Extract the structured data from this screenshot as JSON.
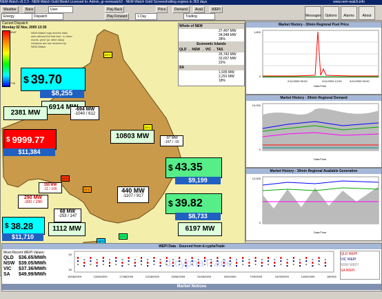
{
  "title": "NEM-Watch v9.2.3 - NEM-Watch Gold Model   Licensed to: Admin,  gr-nemwatch2 - NEM-Watch Gold Screenshotting expires in 363 days",
  "site": "www.nem-watch.info",
  "toolbar": {
    "weather": "Weather",
    "bans": "Bans",
    "user": "User",
    "energy": "Energy",
    "dispatch": "Dispatch",
    "play_back": "Play Back",
    "play_forward": "Play Forward",
    "interval": "1 Day",
    "price": "Price",
    "demand": "Demand",
    "avail": "Avail",
    "wepi": "WEPI",
    "trading": "Trading",
    "messages": "Messages",
    "options": "Options",
    "alarms": "Alarms",
    "about": "About"
  },
  "dispatch": {
    "label": "Current Dispatch",
    "time": "Monday 02 Nov, 2009 13:30",
    "note": "NEM-Watch logs receive data sets without the first test - in other words, price (or other data) revisions are not received by NEM-Watch",
    "legend_top": "3047",
    "legend_bottom": "778"
  },
  "regions": {
    "qld": {
      "price": "39.70",
      "demand_sub": "$8,255",
      "mw": "6914 MW"
    },
    "sa": {
      "mw": "2381 MW",
      "price": "9999.77",
      "demand_sub": "$11,384"
    },
    "nsw": {
      "mw": "10803 MW",
      "price": "43.35",
      "demand_sub": "$9,199"
    },
    "vic": {
      "price": "39.82",
      "demand_sub": "$8,733",
      "mw": "6197 MW"
    },
    "tas": {
      "price": "38.28",
      "demand_sub": "$11,710",
      "mw": "1112 MW"
    }
  },
  "flows": {
    "qni": {
      "value": "-694 MW",
      "limits": "-1040 / 612"
    },
    "sa_vic": {
      "value": "156 MW",
      "limits": "-11 / 166"
    },
    "murraylink": {
      "value": "290 MW",
      "limits": "-300 / 290"
    },
    "basslink": {
      "value": "68 MW",
      "limits": "-253 / 147"
    },
    "vic_nsw": {
      "value": "440 MW",
      "limits": "-1107 / 917"
    },
    "directlink": {
      "value": "-97 MW",
      "limits": "-167 / -15"
    }
  },
  "stations": {
    "st1": "29°C",
    "st2": "26°C",
    "st3": "31°C",
    "st4": "37°C",
    "st5": "18°C",
    "st6": "27°C"
  },
  "summary": {
    "header_whole": "Whole of NEM",
    "whole": [
      "27,407 MW",
      "34,948 MW",
      "28%"
    ],
    "header_islands": "Economic Islands",
    "header_islands2": "QLD → NSW → VIC → TAS",
    "islands": [
      "26,742 MW",
      "32,657 MW",
      "22%"
    ],
    "sa_label": "SA",
    "sa": [
      "1,935 MW",
      "2,291 MW",
      "18%"
    ]
  },
  "charts": {
    "price": {
      "title": "Market History - 30min Regional Pool Price",
      "ylabel": "Price ($/MWh)",
      "xlabel": "Date/Time",
      "ticks_x": [
        "2/11/2009 00:00",
        "2/11/2009 12:00",
        "3/11/2009 00:00"
      ],
      "ticks_y": [
        "1,600",
        "1,400",
        "1,200",
        "1,000",
        "800",
        "600",
        "400",
        "200",
        "0"
      ]
    },
    "demand": {
      "title": "Market History - 30min Regional Demand",
      "ylabel": "Demand (MW)",
      "xlabel": "Date/Time",
      "ticks_y": [
        "10,000",
        "8,000",
        "6,000",
        "4,000",
        "2,000",
        "0"
      ]
    },
    "avail": {
      "title": "Market History - 30min Regional Available Generation",
      "ylabel": "Generation (MW)",
      "xlabel": "Date/Time",
      "ticks_y": [
        "12,000",
        "10,000",
        "8,000",
        "6,000",
        "4,000",
        "2,000",
        "0"
      ]
    },
    "legend_price": [
      "SA",
      "VIC",
      "NSW",
      "QLD",
      "TAS"
    ],
    "legend_demand": [
      "NEM",
      "SA",
      "VIC",
      "NSW",
      "QLD",
      "TAS"
    ]
  },
  "wepi": {
    "title": "WEPI Data - Sourced from d-cyphaTrade",
    "recent_label": "Most Recent WEPI Values:",
    "rows": [
      [
        "QLD",
        "$36.65/MWh"
      ],
      [
        "NSW",
        "$39.05/MWh"
      ],
      [
        "VIC",
        "$37.36/MWh"
      ],
      [
        "SA",
        "$49.99/MWh"
      ]
    ],
    "ticks_x": [
      "10/08/2009",
      "13/08/2009",
      "17/08/2009",
      "21/08/2009",
      "25/08/2009",
      "31/08/2009",
      "3/09/2009",
      "7/09/2009",
      "10/09/2009",
      "14/09/2009",
      "18/09/2009"
    ],
    "ticks_y": [
      "50",
      "40",
      "30"
    ],
    "legend": [
      "QLD WEPI",
      "VIC WEPI",
      "NSW WEPI",
      "SA WEPI"
    ],
    "watermark": "d-cyphaTrade",
    "market_notices": "Market Notices"
  }
}
